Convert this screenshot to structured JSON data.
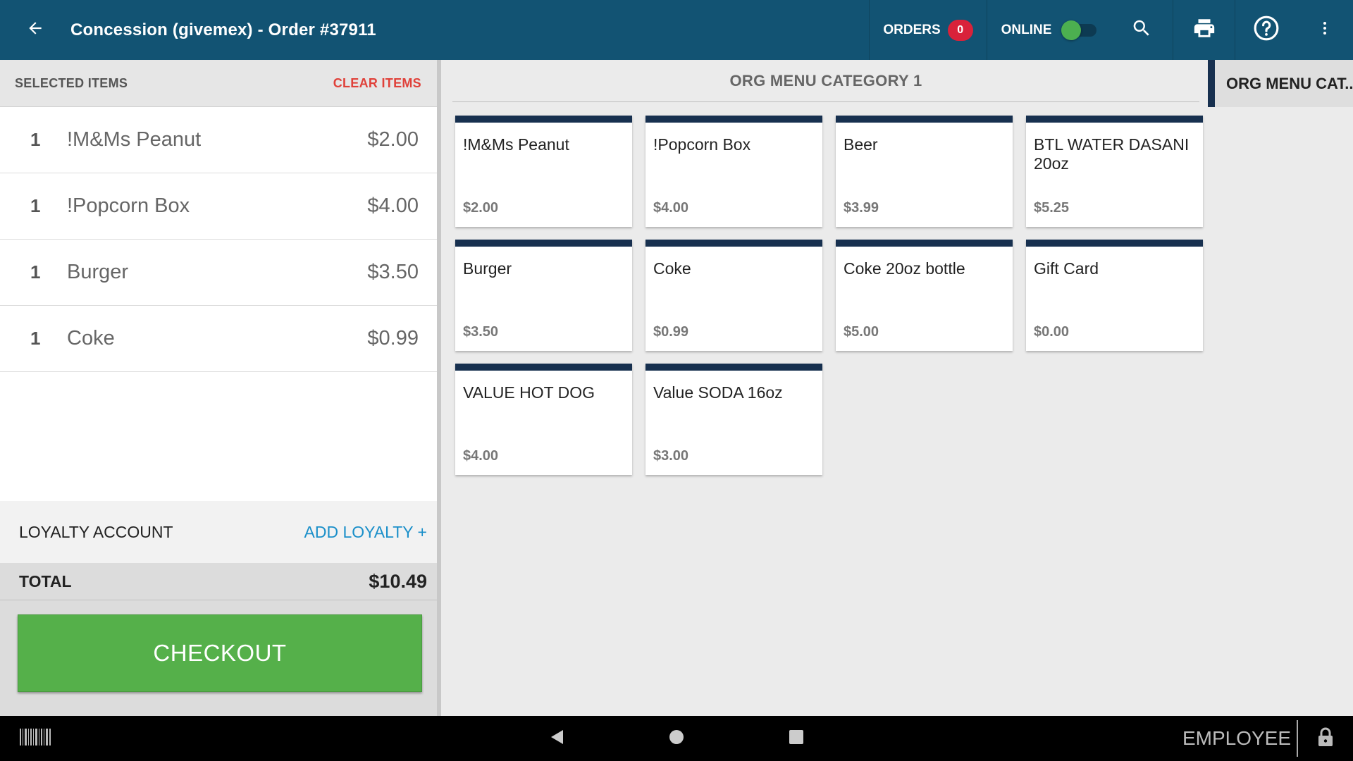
{
  "header": {
    "title": "Concession (givemex) - Order #37911",
    "orders_label": "ORDERS",
    "orders_count": "0",
    "online_label": "ONLINE",
    "online_status": true,
    "icons": [
      "back-arrow-icon",
      "search-icon",
      "print-icon",
      "help-icon",
      "more-vert-icon"
    ]
  },
  "cart": {
    "header_label": "SELECTED ITEMS",
    "clear_label": "CLEAR ITEMS",
    "items": [
      {
        "qty": "1",
        "name": "!M&Ms Peanut",
        "price": "$2.00"
      },
      {
        "qty": "1",
        "name": "!Popcorn Box",
        "price": "$4.00"
      },
      {
        "qty": "1",
        "name": "Burger",
        "price": "$3.50"
      },
      {
        "qty": "1",
        "name": "Coke",
        "price": "$0.99"
      }
    ],
    "loyalty_label": "LOYALTY ACCOUNT",
    "add_loyalty_label": "ADD LOYALTY +",
    "total_label": "TOTAL",
    "total_value": "$10.49",
    "checkout_label": "CHECKOUT"
  },
  "menu": {
    "category_title": "ORG MENU CATEGORY 1",
    "products": [
      {
        "name": "!M&Ms Peanut",
        "price": "$2.00"
      },
      {
        "name": "!Popcorn Box",
        "price": "$4.00"
      },
      {
        "name": "Beer",
        "price": "$3.99"
      },
      {
        "name": "BTL WATER DASANI 20oz",
        "price": "$5.25"
      },
      {
        "name": "Burger",
        "price": "$3.50"
      },
      {
        "name": "Coke",
        "price": "$0.99"
      },
      {
        "name": "Coke 20oz bottle",
        "price": "$5.00"
      },
      {
        "name": "Gift Card",
        "price": "$0.00"
      },
      {
        "name": "VALUE HOT DOG",
        "price": "$4.00"
      },
      {
        "name": "Value SODA 16oz",
        "price": "$3.00"
      }
    ]
  },
  "categories": {
    "active_tab": "ORG MENU CAT..."
  },
  "system_bar": {
    "employee_label": "EMPLOYEE",
    "icons": [
      "barcode-icon",
      "nav-back-icon",
      "nav-home-icon",
      "nav-recents-icon",
      "lock-icon"
    ]
  },
  "colors": {
    "header_bg": "#125373",
    "badge": "#d9223a",
    "online_knob": "#4caf50",
    "clear_items": "#e0413a",
    "add_loyalty": "#1a8fc9",
    "checkout": "#55b04a",
    "card_top": "#17304f"
  }
}
